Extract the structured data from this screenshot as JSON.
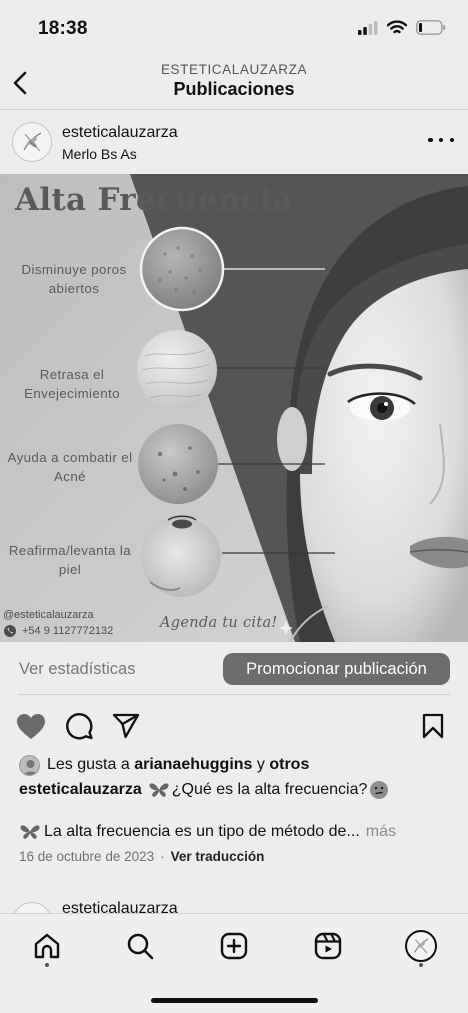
{
  "status_bar": {
    "time": "18:38"
  },
  "nav": {
    "subtitle": "ESTETICALAUZARZA",
    "title": "Publicaciones"
  },
  "post": {
    "username": "esteticalauzarza",
    "location": "Merlo Bs As",
    "image": {
      "title": "Alta Frecuencia",
      "benefits": [
        "Disminuye poros abiertos",
        "Retrasa el Envejecimiento",
        "Ayuda a combatir el Acné",
        "Reafirma/levanta la piel"
      ],
      "handle": "@esteticalauzarza",
      "phone": "+54 9 1127772132",
      "cta": "Agenda tu cita!"
    },
    "insights": {
      "stats_label": "Ver estadísticas",
      "promote_label": "Promocionar publicación"
    },
    "likes": {
      "prefix": "Les gusta a",
      "user": "arianaehuggins",
      "joiner": "y",
      "others": "otros"
    },
    "caption": {
      "user": "esteticalauzarza",
      "text": "¿Qué es la alta frecuencia?",
      "line2": "La alta frecuencia es un tipo de método de...",
      "more": "más"
    },
    "date": "16 de octubre de 2023",
    "separator": "·",
    "translate": "Ver traducción"
  },
  "next_post": {
    "username": "esteticalauzarza"
  },
  "icons": {
    "statusbar": [
      "signal-icon",
      "wifi-icon",
      "battery-icon"
    ],
    "actions": [
      "heart-icon",
      "comment-icon",
      "share-icon",
      "bookmark-icon"
    ],
    "tabbar": [
      "home-icon",
      "search-icon",
      "create-icon",
      "reels-icon",
      "profile-icon"
    ]
  }
}
